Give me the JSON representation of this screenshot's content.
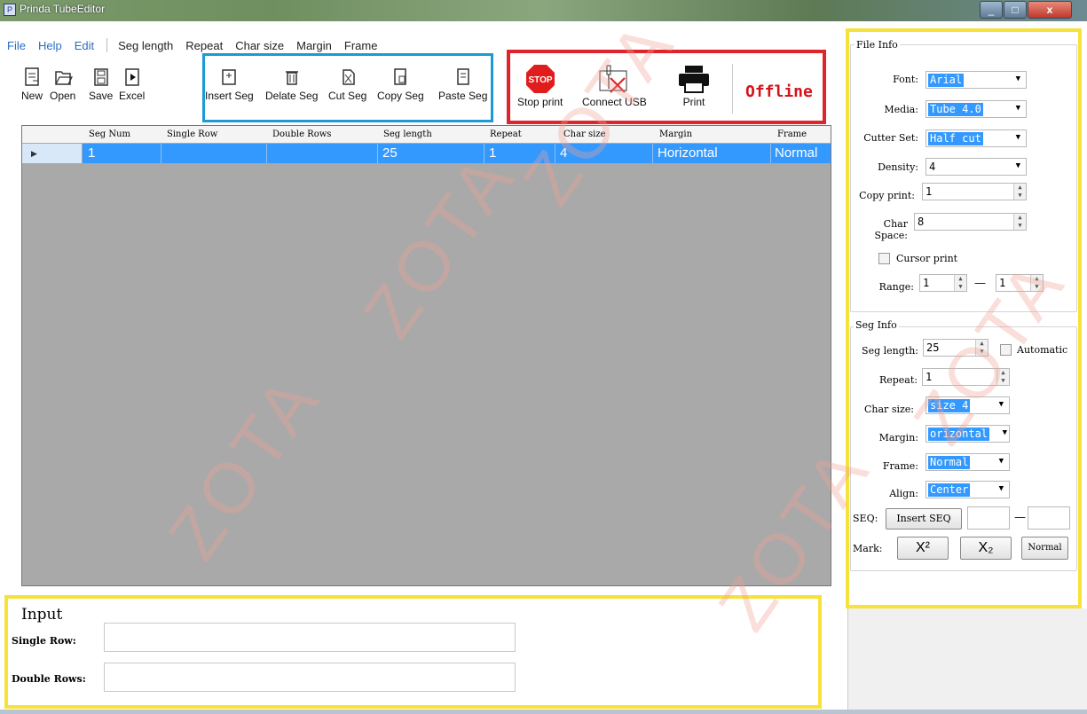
{
  "window": {
    "title": "Prinda TubeEditor",
    "close_glyph": "x"
  },
  "menu": {
    "items": [
      "File",
      "Help",
      "Edit"
    ],
    "column_items": [
      "Seg length",
      "Repeat",
      "Char size",
      "Margin",
      "Frame"
    ]
  },
  "toolbar": {
    "file_buttons": [
      "New",
      "Open",
      "Save",
      "Excel"
    ],
    "seg_buttons": [
      "Insert Seg",
      "Delate Seg",
      "Cut Seg",
      "Copy Seg",
      "Paste Seg"
    ],
    "print_buttons": [
      "Stop print",
      "Connect USB",
      "Print"
    ],
    "stop_icon_text": "STOP",
    "status": "Offline"
  },
  "grid": {
    "columns": [
      "Seg Num",
      "Single Row",
      "Double Rows",
      "Seg length",
      "Repeat",
      "Char size",
      "Margin",
      "Frame"
    ],
    "rows": [
      {
        "seg_num": "1",
        "single_row": "",
        "double_rows": "",
        "seg_length": "25",
        "repeat": "1",
        "char_size": "4",
        "margin": "Horizontal",
        "frame": "Normal"
      }
    ]
  },
  "file_info": {
    "title": "File Info",
    "font_label": "Font:",
    "font_value": "Arial",
    "media_label": "Media:",
    "media_value": "Tube 4.0",
    "cutter_label": "Cutter Set:",
    "cutter_value": "Half cut",
    "density_label": "Density:",
    "density_value": "4",
    "copy_label": "Copy print:",
    "copy_value": "1",
    "char_space_label": "Char Space:",
    "char_space_value": "8",
    "cursor_print_label": "Cursor print",
    "range_label": "Range:",
    "range_from": "1",
    "range_to": "1",
    "range_dash": "—"
  },
  "seg_info": {
    "title": "Seg Info",
    "seg_length_label": "Seg length:",
    "seg_length_value": "25",
    "automatic_label": "Automatic",
    "repeat_label": "Repeat:",
    "repeat_value": "1",
    "char_size_label": "Char size:",
    "char_size_value": "size 4",
    "margin_label": "Margin:",
    "margin_value": "orizontal",
    "frame_label": "Frame:",
    "frame_value": "Normal",
    "align_label": "Align:",
    "align_value": "Center",
    "seq_label": "SEQ:",
    "insert_seq": "Insert SEQ",
    "seq_dash": "—",
    "mark_label": "Mark:",
    "superscript": "X²",
    "subscript": "X₂",
    "normal": "Normal"
  },
  "input": {
    "title": "Input",
    "single_row_label": "Single Row:",
    "double_rows_label": "Double Rows:"
  },
  "watermark": "ZOTA"
}
